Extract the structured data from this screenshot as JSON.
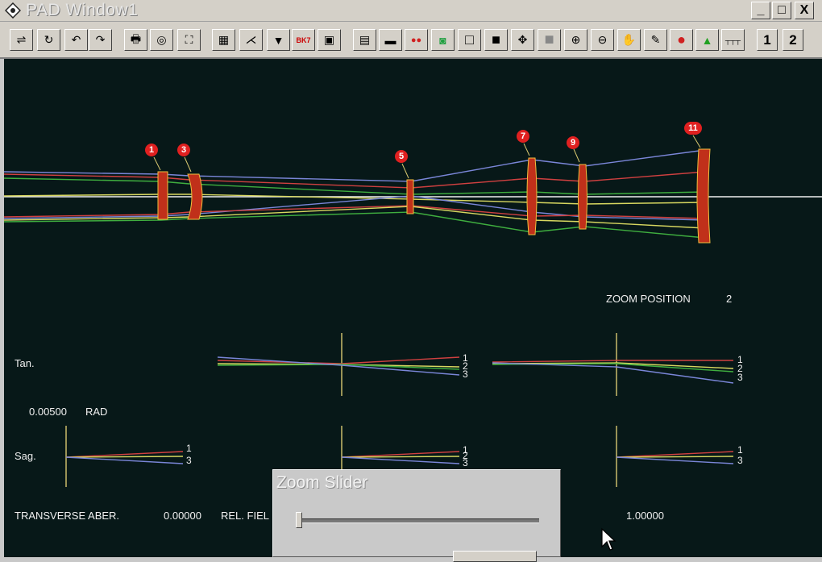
{
  "window": {
    "title": "PAD Window1",
    "buttons": [
      "_",
      "□",
      "X"
    ]
  },
  "toolbar": {
    "buttons": [
      {
        "name": "sliders-icon",
        "glyph": "⇌"
      },
      {
        "name": "refresh-icon",
        "glyph": "↻"
      },
      {
        "name": "undo-icon",
        "glyph": "↶"
      },
      {
        "name": "redo-icon",
        "glyph": "↷"
      },
      {
        "name": "print-icon",
        "glyph": "🖶"
      },
      {
        "name": "zoom-lens-icon",
        "glyph": "◎"
      },
      {
        "name": "fit-view-icon",
        "glyph": "⛶"
      },
      {
        "name": "film-icon",
        "glyph": "▦"
      },
      {
        "name": "ray-fan-icon",
        "glyph": "⋌"
      },
      {
        "name": "vignette-icon",
        "glyph": "▼"
      },
      {
        "name": "glass-code-icon",
        "glyph": "BK7"
      },
      {
        "name": "frame-icon",
        "glyph": "▣"
      },
      {
        "name": "grid-icon",
        "glyph": "▤"
      },
      {
        "name": "keypad-icon",
        "glyph": "▬"
      },
      {
        "name": "color-dots-icon",
        "glyph": "●●"
      },
      {
        "name": "camera-icon",
        "glyph": "◙"
      },
      {
        "name": "white-square-icon",
        "glyph": "□"
      },
      {
        "name": "black-square-icon",
        "glyph": "■"
      },
      {
        "name": "expand-icon",
        "glyph": "✥"
      },
      {
        "name": "gray-square-icon",
        "glyph": "■"
      },
      {
        "name": "zoom-in-icon",
        "glyph": "⊕"
      },
      {
        "name": "zoom-out-icon",
        "glyph": "⊖"
      },
      {
        "name": "hand-icon",
        "glyph": "✋"
      },
      {
        "name": "pencil-icon",
        "glyph": "✎"
      },
      {
        "name": "red-marker-icon",
        "glyph": "●"
      },
      {
        "name": "color-marker-icon",
        "glyph": "▲"
      },
      {
        "name": "ruler-icon",
        "glyph": "┬┬┬"
      }
    ],
    "page_buttons": [
      "1",
      "2"
    ]
  },
  "canvas": {
    "surface_labels": [
      "1",
      "3",
      "5",
      "7",
      "9",
      "11"
    ],
    "zoom_position_label": "ZOOM POSITION",
    "zoom_position_value": "2",
    "tan_label": "Tan.",
    "sag_label": "Sag.",
    "scale_value": "0.00500",
    "scale_unit": "RAD",
    "fan_numbers": [
      "1",
      "2",
      "3"
    ],
    "transverse_label": "TRANSVERSE ABER.",
    "transverse_value": "0.00000",
    "rel_field_label": "REL. FIEL",
    "right_value": "1.00000"
  },
  "zoom_slider": {
    "title": "Zoom Slider",
    "value": 0.0
  },
  "colors": {
    "background": "#071818",
    "lens": "#c0301a",
    "ray_blue": "#7a86d8",
    "ray_red": "#d04040",
    "ray_green": "#3fae3f",
    "ray_yellow": "#d8d860",
    "ray_white": "#f0f0f0",
    "axis": "#d8c870"
  }
}
